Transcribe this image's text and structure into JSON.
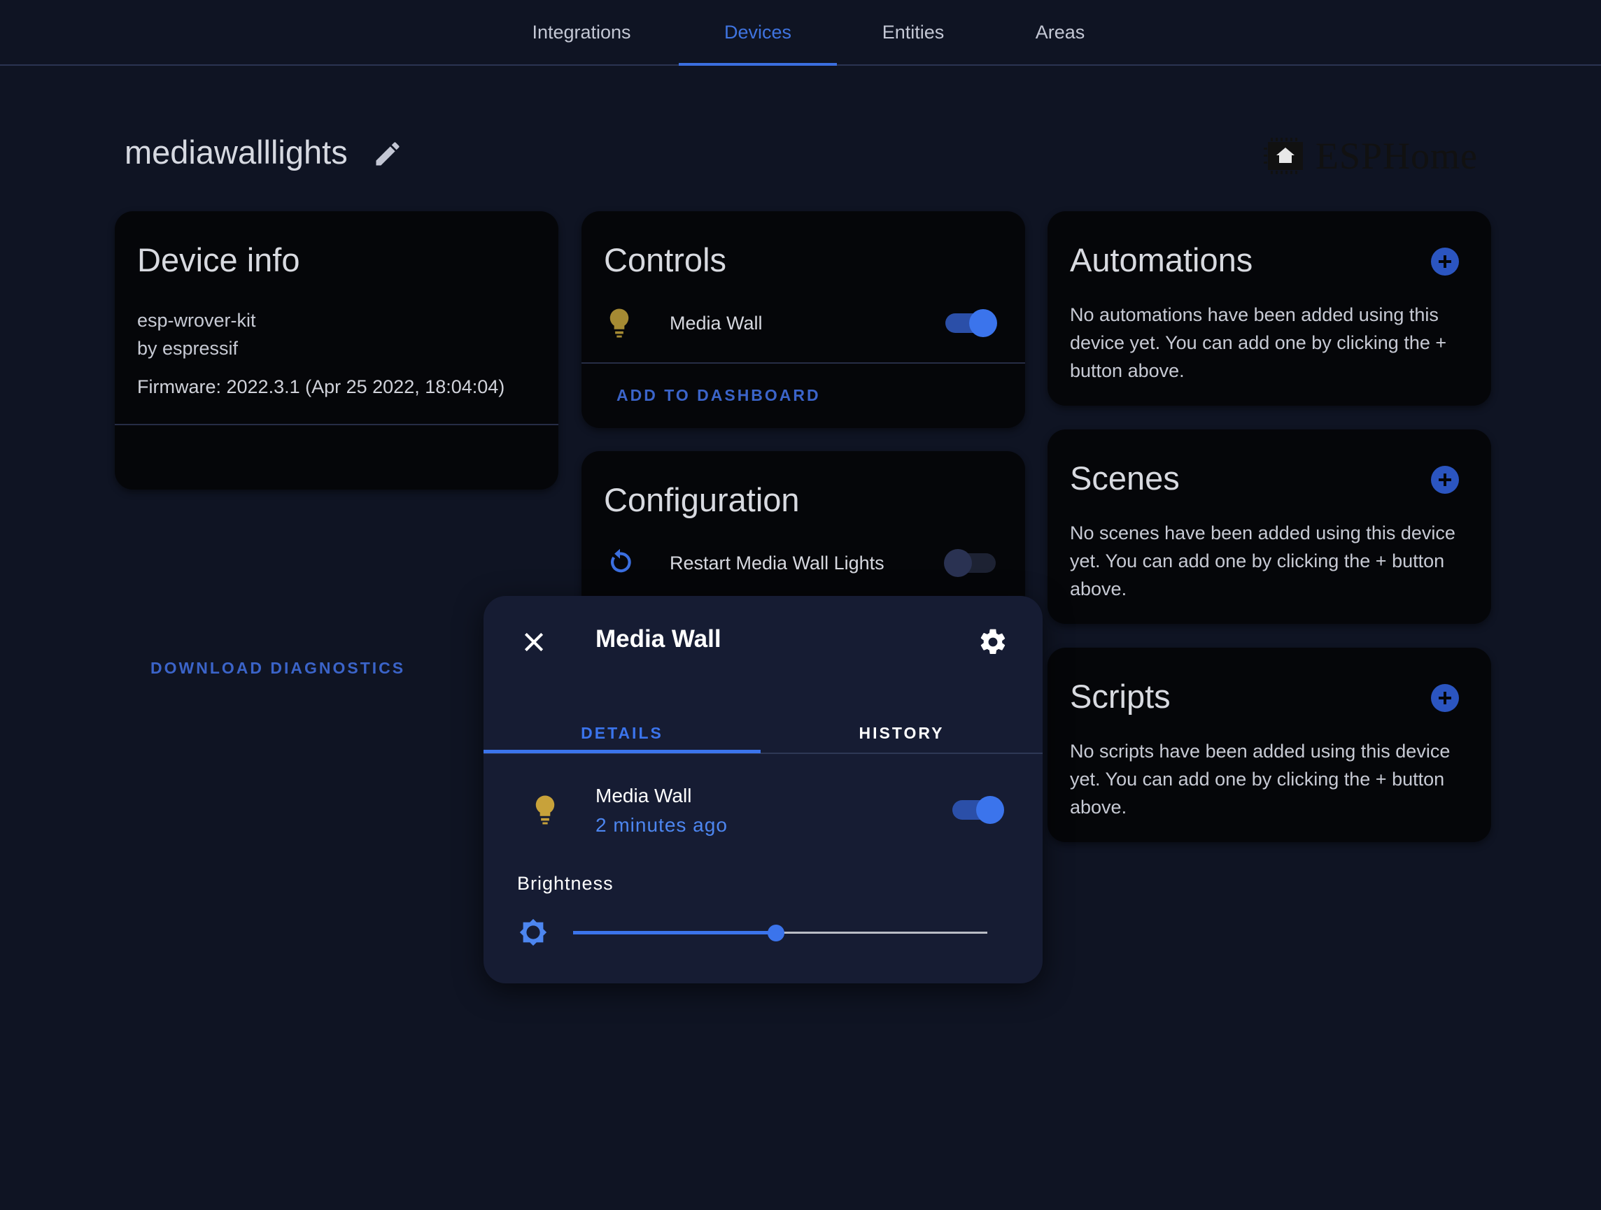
{
  "nav": {
    "tabs": [
      {
        "label": "Integrations",
        "active": false
      },
      {
        "label": "Devices",
        "active": true
      },
      {
        "label": "Entities",
        "active": false
      },
      {
        "label": "Areas",
        "active": false
      }
    ]
  },
  "header": {
    "title": "mediawalllights",
    "brand": "ESPHome"
  },
  "device_info": {
    "title": "Device info",
    "model": "esp-wrover-kit",
    "manufacturer": "by espressif",
    "firmware": "Firmware: 2022.3.1 (Apr 25 2022, 18:04:04)",
    "download_label": "DOWNLOAD DIAGNOSTICS"
  },
  "controls": {
    "title": "Controls",
    "entity_name": "Media Wall",
    "entity_on": true,
    "add_label": "ADD TO DASHBOARD"
  },
  "configuration": {
    "title": "Configuration",
    "entity_name": "Restart Media Wall Lights",
    "entity_on": false
  },
  "automations": {
    "title": "Automations",
    "empty_text": "No automations have been added using this device yet. You can add one by clicking the + button above."
  },
  "scenes": {
    "title": "Scenes",
    "empty_text": "No scenes have been added using this device yet. You can add one by clicking the + button above."
  },
  "scripts": {
    "title": "Scripts",
    "empty_text": "No scripts have been added using this device yet. You can add one by clicking the + button above."
  },
  "dialog": {
    "title": "Media Wall",
    "tabs": {
      "details": "DETAILS",
      "history": "HISTORY"
    },
    "active_tab": "details",
    "entity_name": "Media Wall",
    "last_changed": "2 minutes ago",
    "entity_on": true,
    "brightness_label": "Brightness",
    "brightness_fraction": 0.49
  },
  "colors": {
    "accent": "#3b74ec",
    "bulb": "#c8a23a",
    "background": "#0f1423",
    "card": "#050609"
  },
  "icons": {
    "edit": "pencil-icon",
    "bulb": "lightbulb-icon",
    "restart": "restart-icon",
    "add": "plus-circle-icon",
    "close": "close-icon",
    "settings": "gear-icon",
    "brightness": "brightness-icon"
  }
}
